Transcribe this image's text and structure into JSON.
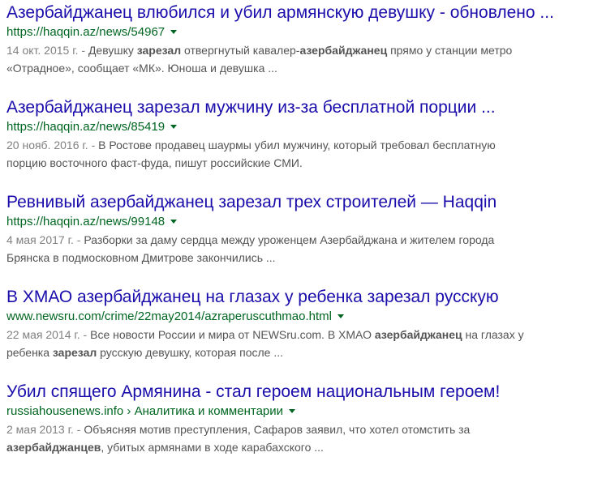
{
  "results": [
    {
      "title": "Азербайджанец влюбился и убил армянскую девушку - обновлено ...",
      "url": "https://haqqin.az/news/54967",
      "line1": [
        {
          "text": "14 окт. 2015 г. - ",
          "style": "date"
        },
        {
          "text": "Девушку "
        },
        {
          "text": "зарезал",
          "style": "bold"
        },
        {
          "text": " отвергнутый кавалер-"
        },
        {
          "text": "азербайджанец",
          "style": "bold"
        },
        {
          "text": " прямо у станции метро"
        }
      ],
      "line2": [
        {
          "text": "«Отрадное», сообщает «МК». Юноша и девушка ..."
        }
      ]
    },
    {
      "title": "Азербайджанец зарезал мужчину из-за бесплатной порции ...",
      "url": "https://haqqin.az/news/85419",
      "line1": [
        {
          "text": "20 нояб. 2016 г. - ",
          "style": "date"
        },
        {
          "text": "В Ростове продавец шаурмы убил мужчину, который требовал бесплатную"
        }
      ],
      "line2": [
        {
          "text": "порцию восточного фаст-фуда, пишут российские СМИ."
        }
      ]
    },
    {
      "title": "Ревнивый азербайджанец зарезал трех строителей — Haqqin",
      "url": "https://haqqin.az/news/99148",
      "line1": [
        {
          "text": "4 мая 2017 г. - ",
          "style": "date"
        },
        {
          "text": "Разборки за даму сердца между уроженцем Азербайджана и жителем города"
        }
      ],
      "line2": [
        {
          "text": "Брянска в подмосковном Дмитрове закончились ..."
        }
      ]
    },
    {
      "title": "В ХМАО азербайджанец на глазах у ребенка зарезал русскую",
      "url": "www.newsru.com/crime/22may2014/azraperuscuthmao.html",
      "line1": [
        {
          "text": "22 мая 2014 г. - ",
          "style": "date"
        },
        {
          "text": "Все новости России и мира от NEWSru.com. В ХМАО "
        },
        {
          "text": "азербайджанец",
          "style": "bold"
        },
        {
          "text": " на глазах у"
        }
      ],
      "line2": [
        {
          "text": "ребенка "
        },
        {
          "text": "зарезал",
          "style": "bold"
        },
        {
          "text": " русскую девушку, которая после ..."
        }
      ]
    },
    {
      "title": "Убил спящего Армянина - стал героем национальным героем!",
      "url": "russiahousenews.info › Аналитика и комментарии",
      "line1": [
        {
          "text": "2 мая 2013 г. - ",
          "style": "date"
        },
        {
          "text": "Объясняя мотив преступления, Сафаров заявил, что хотел отомстить за"
        }
      ],
      "line2": [
        {
          "text": "азербайджанцев",
          "style": "bold"
        },
        {
          "text": ", убитых армянами в ходе карабахского ..."
        }
      ]
    }
  ]
}
